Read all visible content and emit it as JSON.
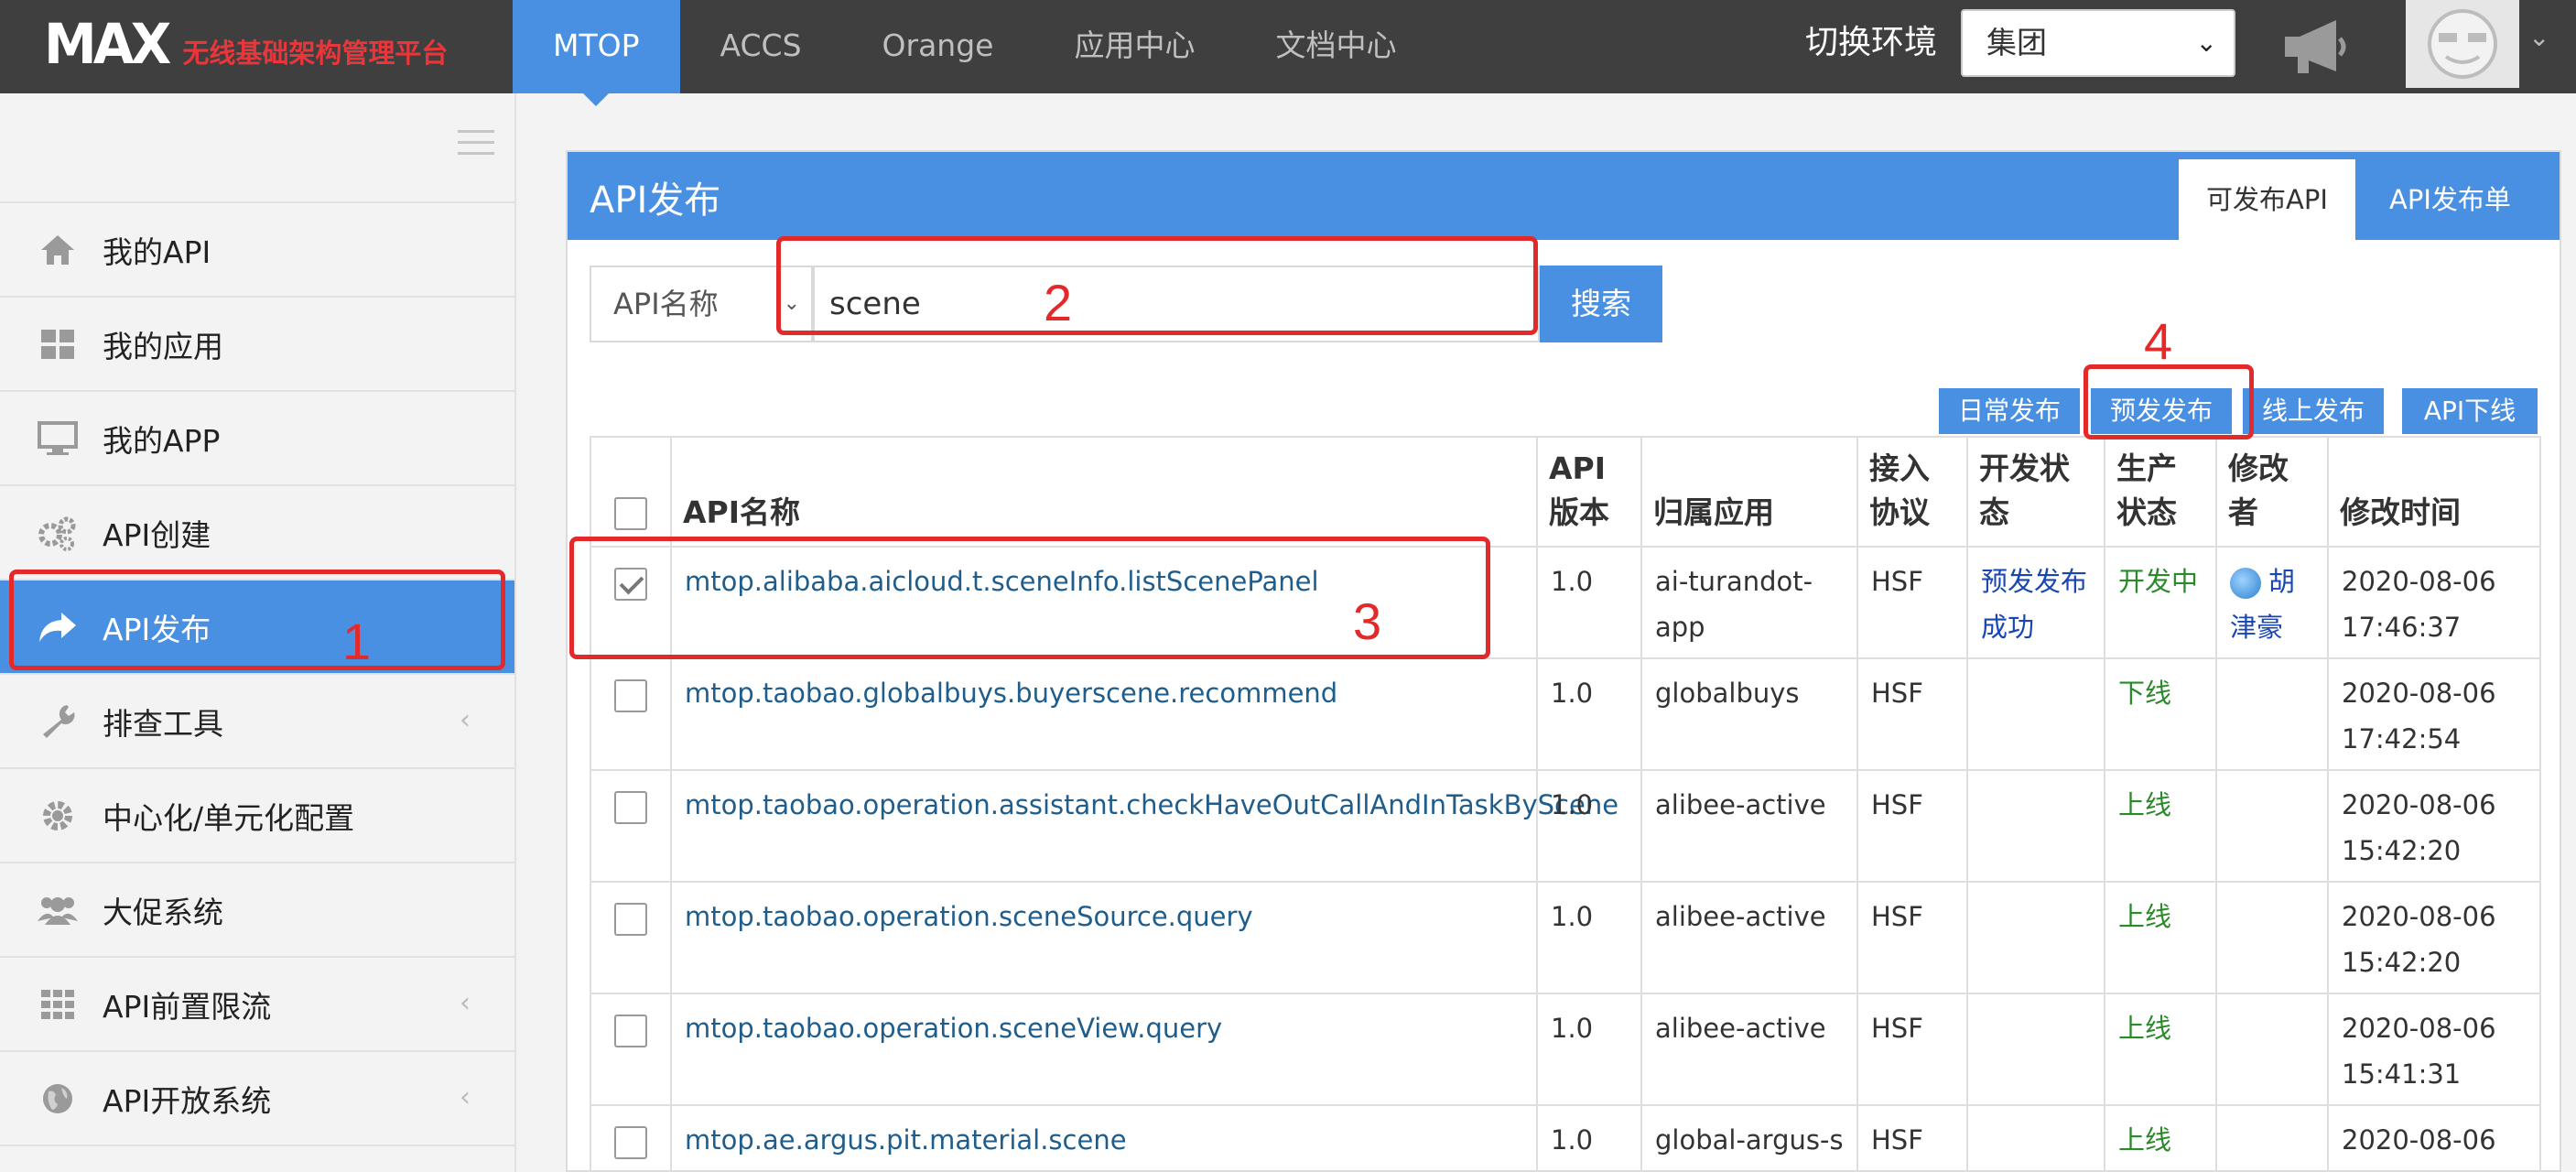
{
  "header": {
    "logo_main": "MAX",
    "logo_sub": "无线基础架构管理平台",
    "nav": [
      "MTOP",
      "ACCS",
      "Orange",
      "应用中心",
      "文档中心"
    ],
    "env_label": "切换环境",
    "env_value": "集团"
  },
  "sidebar": {
    "items": [
      {
        "label": "我的API"
      },
      {
        "label": "我的应用"
      },
      {
        "label": "我的APP"
      },
      {
        "label": "API创建"
      },
      {
        "label": "API发布"
      },
      {
        "label": "排查工具"
      },
      {
        "label": "中心化/单元化配置"
      },
      {
        "label": "大促系统"
      },
      {
        "label": "API前置限流"
      },
      {
        "label": "API开放系统"
      }
    ]
  },
  "panel": {
    "title": "API发布",
    "tabs": [
      "可发布API",
      "API发布单"
    ],
    "search_type": "API名称",
    "search_value": "scene",
    "search_button": "搜索",
    "actions": [
      "日常发布",
      "预发发布",
      "线上发布",
      "API下线"
    ]
  },
  "table": {
    "headers": [
      "API名称",
      "API版本",
      "归属应用",
      "接入协议",
      "开发状态",
      "生产状态",
      "修改者",
      "修改时间"
    ],
    "rows": [
      {
        "checked": true,
        "name": "mtop.alibaba.aicloud.t.sceneInfo.listScenePanel",
        "version": "1.0",
        "app": "ai-turandot-app",
        "protocol": "HSF",
        "dev_status": "预发发布成功",
        "prod_status": "开发中",
        "modifier": "胡津豪",
        "time": "2020-08-06 17:46:37"
      },
      {
        "checked": false,
        "name": "mtop.taobao.globalbuys.buyerscene.recommend",
        "version": "1.0",
        "app": "globalbuys",
        "protocol": "HSF",
        "dev_status": "",
        "prod_status": "下线",
        "modifier": "",
        "time": "2020-08-06 17:42:54"
      },
      {
        "checked": false,
        "name": "mtop.taobao.operation.assistant.checkHaveOutCallAndInTaskByScene",
        "version": "1.0",
        "app": "alibee-active",
        "protocol": "HSF",
        "dev_status": "",
        "prod_status": "上线",
        "modifier": "",
        "time": "2020-08-06 15:42:20"
      },
      {
        "checked": false,
        "name": "mtop.taobao.operation.sceneSource.query",
        "version": "1.0",
        "app": "alibee-active",
        "protocol": "HSF",
        "dev_status": "",
        "prod_status": "上线",
        "modifier": "",
        "time": "2020-08-06 15:42:20"
      },
      {
        "checked": false,
        "name": "mtop.taobao.operation.sceneView.query",
        "version": "1.0",
        "app": "alibee-active",
        "protocol": "HSF",
        "dev_status": "",
        "prod_status": "上线",
        "modifier": "",
        "time": "2020-08-06 15:41:31"
      },
      {
        "checked": false,
        "name": "mtop.ae.argus.pit.material.scene",
        "version": "1.0",
        "app": "global-argus-s",
        "protocol": "HSF",
        "dev_status": "",
        "prod_status": "上线",
        "modifier": "",
        "time": "2020-08-06"
      }
    ]
  },
  "annotations": [
    "1",
    "2",
    "3",
    "4"
  ],
  "colors": {
    "accent": "#4a90e2",
    "topbar": "#3f3f3f",
    "annotation": "#e32a2a",
    "status_green": "#2a8a2a",
    "status_blue": "#1846b3"
  }
}
